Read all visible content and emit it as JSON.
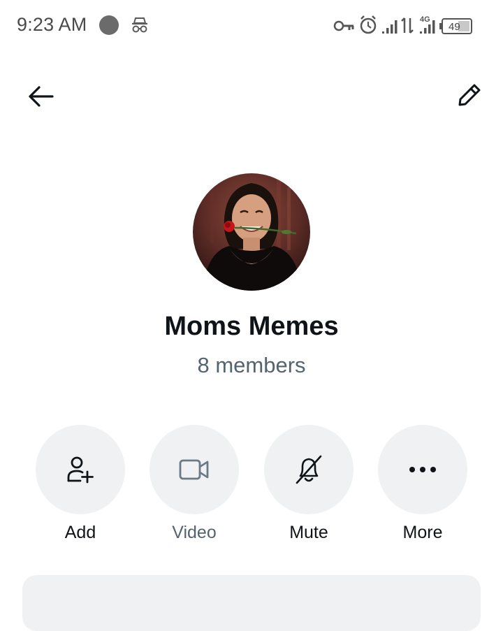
{
  "status_bar": {
    "time": "9:23 AM",
    "network": "4G",
    "battery": "49",
    "icons": [
      "circle-dot-icon",
      "incognito-icon",
      "vpn-key-icon",
      "alarm-icon",
      "signal-icon",
      "data-arrows-icon",
      "signal-4g-icon",
      "battery-icon"
    ]
  },
  "header": {
    "back_icon": "arrow-left-icon",
    "edit_icon": "pencil-icon"
  },
  "group": {
    "name": "Moms Memes",
    "members": "8 members"
  },
  "actions": [
    {
      "label": "Add",
      "icon": "add-person-icon",
      "enabled": true
    },
    {
      "label": "Video",
      "icon": "video-camera-icon",
      "enabled": false
    },
    {
      "label": "Mute",
      "icon": "bell-off-icon",
      "enabled": true
    },
    {
      "label": "More",
      "icon": "more-horizontal-icon",
      "enabled": true
    }
  ],
  "colors": {
    "text_primary": "#0f1419",
    "text_secondary": "#536471",
    "button_bg": "#eff1f3"
  }
}
